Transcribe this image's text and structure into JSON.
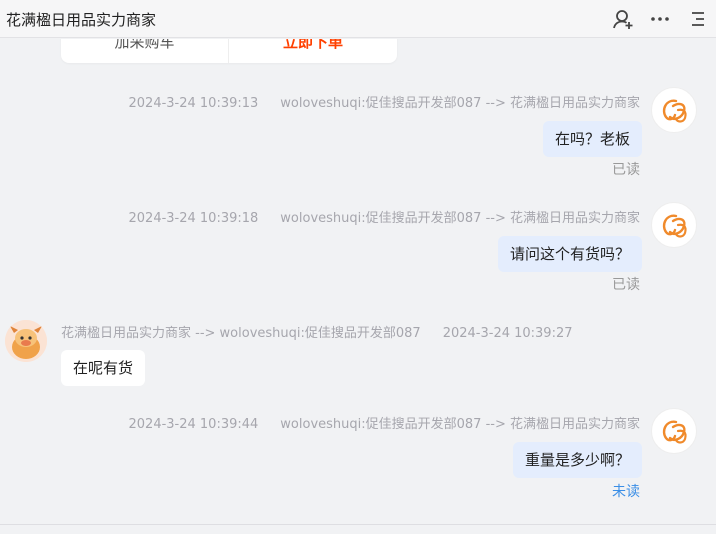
{
  "header": {
    "title": "花满楹日用品实力商家",
    "icons": [
      "add-user-icon",
      "more-icon",
      "menu-icon"
    ]
  },
  "previous_card": {
    "left_label": "加采购车",
    "right_label": "立即下单",
    "right_color": "#ff4000"
  },
  "messages": [
    {
      "direction": "out",
      "timestamp": "2024-3-24 10:39:13",
      "route": "woloveshuqi:促佳搜品开发部087 --> 花满楹日用品实力商家",
      "text": "在吗？老板",
      "status": "已读"
    },
    {
      "direction": "out",
      "timestamp": "2024-3-24 10:39:18",
      "route": "woloveshuqi:促佳搜品开发部087 --> 花满楹日用品实力商家",
      "text": "请问这个有货吗？",
      "status": "已读"
    },
    {
      "direction": "in",
      "timestamp": "2024-3-24 10:39:27",
      "route": "花满楹日用品实力商家 --> woloveshuqi:促佳搜品开发部087",
      "text": "在呢有货"
    },
    {
      "direction": "out",
      "timestamp": "2024-3-24 10:39:44",
      "route": "woloveshuqi:促佳搜品开发部087 --> 花满楹日用品实力商家",
      "text": "重量是多少啊？",
      "status": "未读"
    }
  ],
  "colors": {
    "bubble_out": "#e4edfd",
    "bubble_in": "#ffffff",
    "unread": "#3a8ee6",
    "read": "#999999",
    "avatar_self_stroke": "#f08a2b"
  }
}
